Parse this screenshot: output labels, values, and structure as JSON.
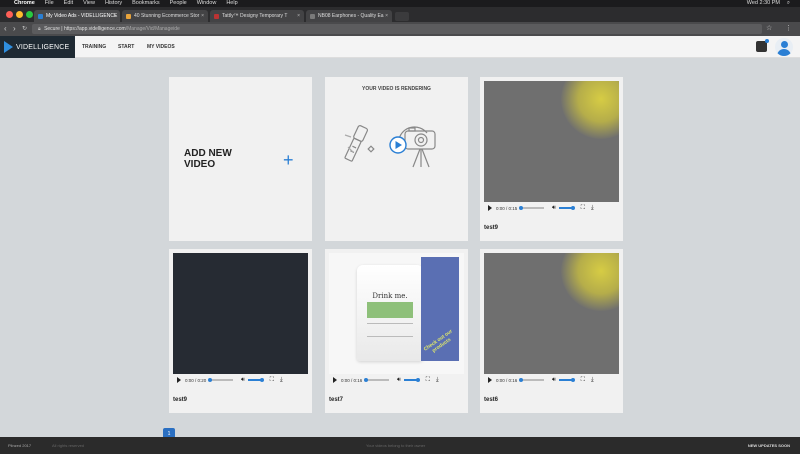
{
  "os_menubar": {
    "items": [
      "Chrome",
      "File",
      "Edit",
      "View",
      "History",
      "Bookmarks",
      "People",
      "Window",
      "Help"
    ],
    "clock": "Wed 2:30 PM"
  },
  "browser": {
    "tabs": [
      {
        "label": "My Video Ads - VIDELLIGENCE",
        "active": true
      },
      {
        "label": "40 Stunning Ecommerce Stor",
        "active": false
      },
      {
        "label": "Tattly™ Designy Temporary T",
        "active": false
      },
      {
        "label": "NB08 Earphones - Quality Ea",
        "active": false
      }
    ],
    "url_secure": "Secure",
    "url_host": "https://app.videlligence.com",
    "url_path": "/Manage/Vid/Manageide"
  },
  "app": {
    "brand": "VIDELLIGENCE",
    "nav": [
      "TRAINING",
      "START",
      "MY VIDEOS"
    ]
  },
  "cards": {
    "add_label": "ADD NEW\nVIDEO",
    "rendering_title": "YOUR VIDEO IS RENDERING",
    "videos": [
      {
        "title": "test9",
        "time": "0:00 / 0:15"
      },
      {
        "title": "test9",
        "time": "0:00 / 0:20"
      },
      {
        "title": "test7",
        "time": "0:00 / 0:16"
      },
      {
        "title": "test6",
        "time": "0:00 / 0:16"
      }
    ],
    "product_title": "Drink me.",
    "product_flag": "Check out our products"
  },
  "pager": {
    "current": "1"
  },
  "footer": {
    "left": "Plinzed 2017",
    "copyright": "All rights reserved",
    "middle": "Your videos belong to their owner",
    "right": "NEW UPDATES SOON"
  },
  "colors": {
    "accent": "#2a7fd4",
    "brand_bg": "#1f2a33",
    "page_bg": "#d3d7da"
  }
}
